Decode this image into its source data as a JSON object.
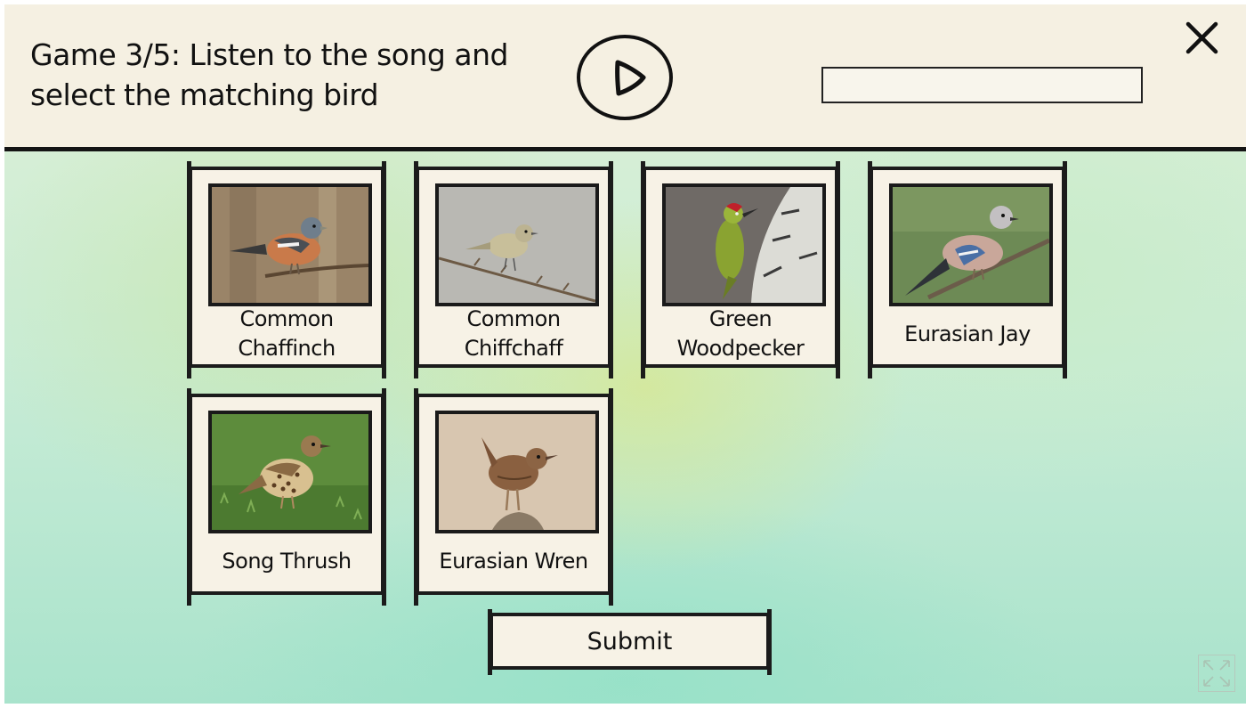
{
  "header": {
    "title": "Game 3/5: Listen to the song and select the matching bird",
    "play_icon": "play-icon",
    "progress": 0,
    "close_icon": "close-icon"
  },
  "birds": [
    {
      "name": "Common Chaffinch",
      "icon": "chaffinch-photo"
    },
    {
      "name": "Common Chiffchaff",
      "icon": "chiffchaff-photo"
    },
    {
      "name": "Green Woodpecker",
      "icon": "woodpecker-photo"
    },
    {
      "name": "Eurasian Jay",
      "icon": "jay-photo"
    },
    {
      "name": "Song Thrush",
      "icon": "thrush-photo"
    },
    {
      "name": "Eurasian Wren",
      "icon": "wren-photo"
    }
  ],
  "submit_label": "Submit",
  "fullscreen_icon": "fullscreen-icon",
  "colors": {
    "header_bg": "#f5f0e2",
    "card_bg": "#f7f2e6",
    "ink": "#111111",
    "bg_green": "#c9ecd6"
  }
}
